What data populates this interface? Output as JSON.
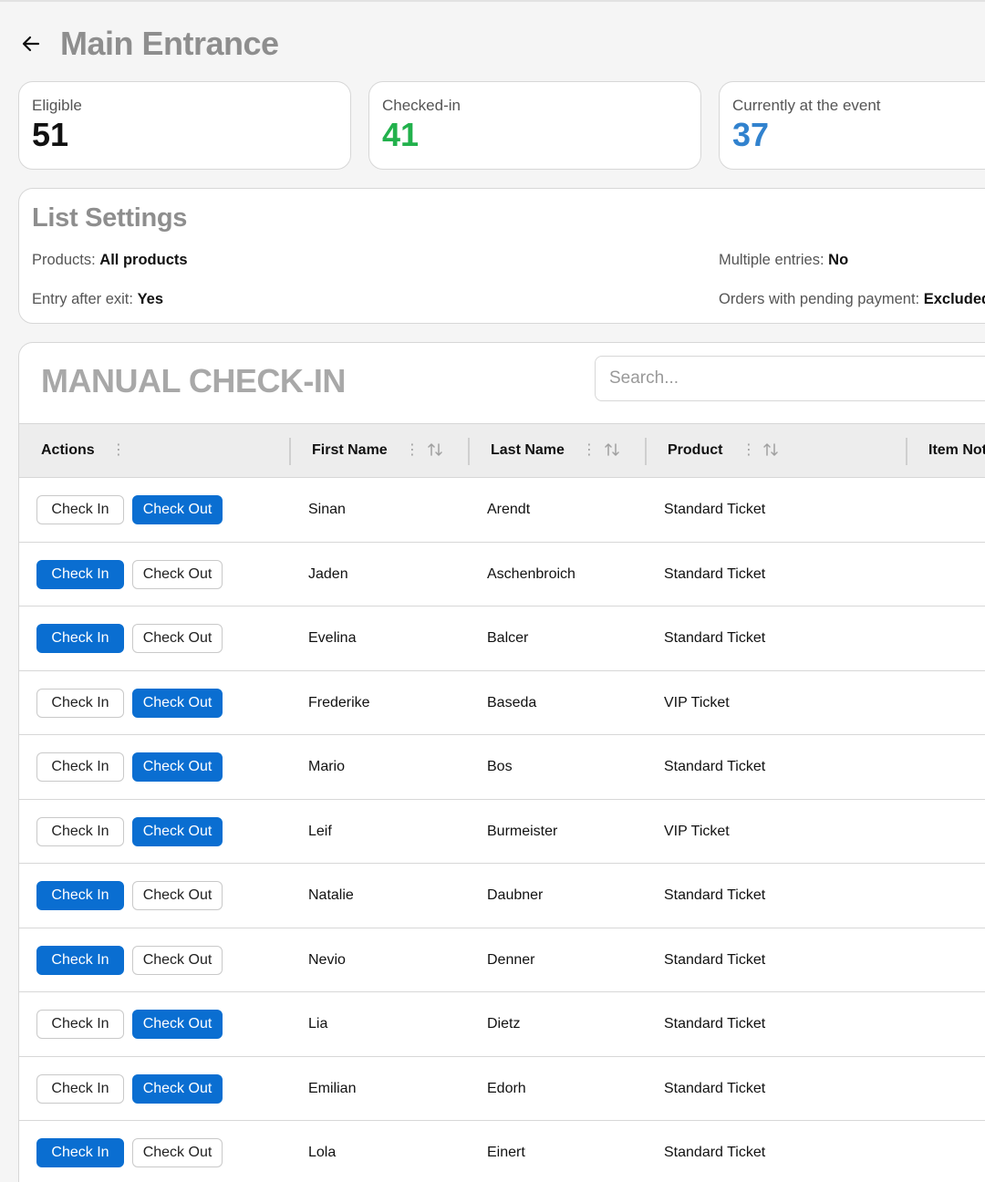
{
  "header": {
    "title": "Main Entrance"
  },
  "stats": [
    {
      "label": "Eligible",
      "value": "51",
      "color": "#111111"
    },
    {
      "label": "Checked-in",
      "value": "41",
      "color": "#22b14c"
    },
    {
      "label": "Currently at the event",
      "value": "37",
      "color": "#3182ce"
    }
  ],
  "settings": {
    "title": "List Settings",
    "products_label": "Products:",
    "products_value": "All products",
    "entry_label": "Entry after exit:",
    "entry_value": "Yes",
    "multiple_label": "Multiple entries:",
    "multiple_value": "No",
    "pending_label": "Orders with pending payment:",
    "pending_value": "Excluded"
  },
  "manual": {
    "title": "MANUAL CHECK-IN",
    "search_placeholder": "Search...",
    "columns": {
      "actions": "Actions",
      "first_name": "First Name",
      "last_name": "Last Name",
      "product": "Product",
      "item_notes": "Item Notes"
    },
    "check_in_label": "Check In",
    "check_out_label": "Check Out",
    "rows": [
      {
        "first": "Sinan",
        "last": "Arendt",
        "product": "Standard Ticket",
        "active": "out"
      },
      {
        "first": "Jaden",
        "last": "Aschenbroich",
        "product": "Standard Ticket",
        "active": "in"
      },
      {
        "first": "Evelina",
        "last": "Balcer",
        "product": "Standard Ticket",
        "active": "in"
      },
      {
        "first": "Frederike",
        "last": "Baseda",
        "product": "VIP Ticket",
        "active": "out"
      },
      {
        "first": "Mario",
        "last": "Bos",
        "product": "Standard Ticket",
        "active": "out"
      },
      {
        "first": "Leif",
        "last": "Burmeister",
        "product": "VIP Ticket",
        "active": "out"
      },
      {
        "first": "Natalie",
        "last": "Daubner",
        "product": "Standard Ticket",
        "active": "in"
      },
      {
        "first": "Nevio",
        "last": "Denner",
        "product": "Standard Ticket",
        "active": "in"
      },
      {
        "first": "Lia",
        "last": "Dietz",
        "product": "Standard Ticket",
        "active": "out"
      },
      {
        "first": "Emilian",
        "last": "Edorh",
        "product": "Standard Ticket",
        "active": "out"
      },
      {
        "first": "Lola",
        "last": "Einert",
        "product": "Standard Ticket",
        "active": "in"
      }
    ]
  }
}
